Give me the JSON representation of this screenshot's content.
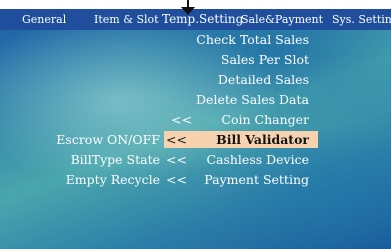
{
  "tabs": [
    {
      "label": "General"
    },
    {
      "label": "Item & Slot"
    },
    {
      "label": "Temp.Setting"
    },
    {
      "label": "Sale&Payment"
    },
    {
      "label": "Sys. Setting"
    }
  ],
  "menu": [
    {
      "label": "Check Total Sales"
    },
    {
      "label": "Sales Per Slot"
    },
    {
      "label": "Detailed Sales"
    },
    {
      "label": "Delete Sales Data"
    },
    {
      "label": "Coin Changer"
    },
    {
      "label": "Bill Validator"
    },
    {
      "label": "Cashless Device"
    },
    {
      "label": "Payment Setting"
    }
  ],
  "arrow": "<<",
  "sub_labels": [
    {
      "label": "Escrow ON/OFF"
    },
    {
      "label": "BillType State"
    },
    {
      "label": "Empty Recycle"
    }
  ],
  "colors": {
    "tab_bar": "#1f4f9c",
    "highlight": "#f6d3ae",
    "text": "#ffffff"
  },
  "icons": [
    "pointer-arrow-icon"
  ]
}
